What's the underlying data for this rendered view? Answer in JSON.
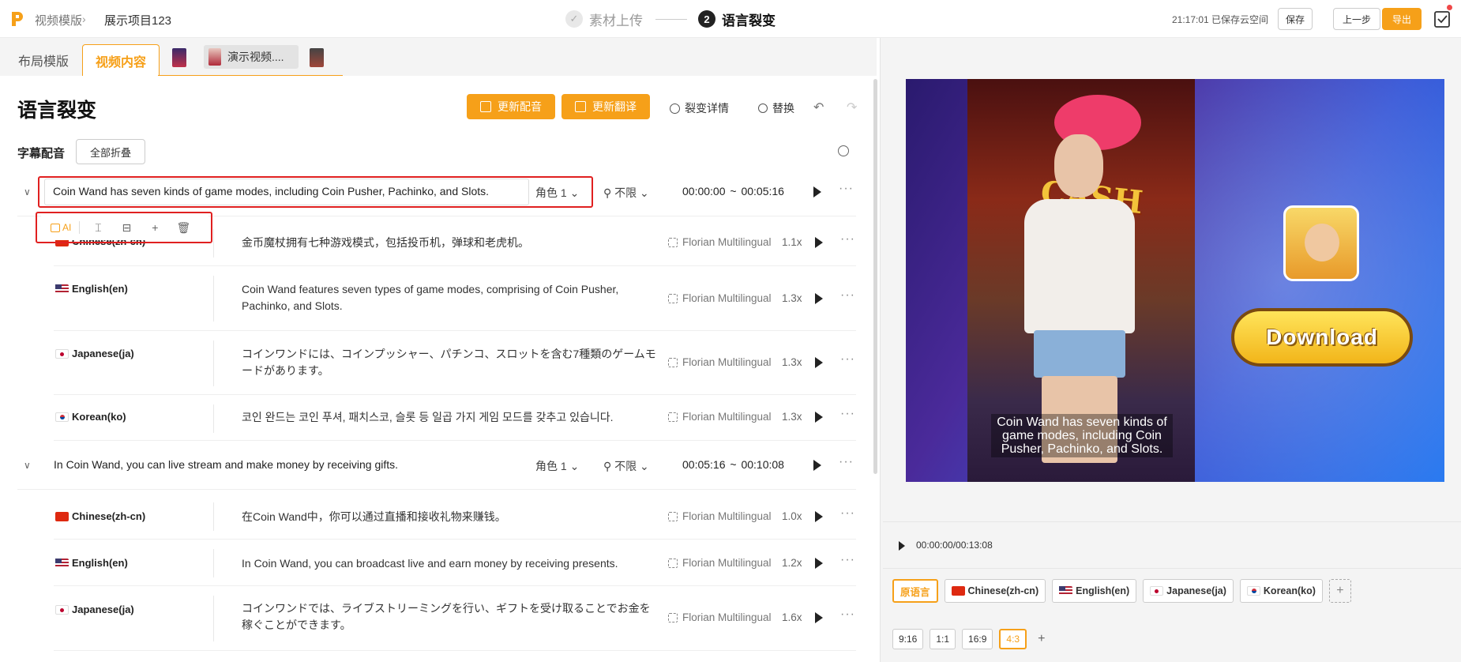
{
  "breadcrumb": {
    "root": "视频模版",
    "separator": "›",
    "project": "展示项目123"
  },
  "steps": [
    {
      "label": "素材上传",
      "done": true
    },
    {
      "label": "语言裂变",
      "number": "2"
    }
  ],
  "topbar": {
    "save_status": "21:17:01 已保存云空间",
    "save_label": "保存",
    "prev_label": "上一步",
    "export_label": "导出"
  },
  "tabs": {
    "layout": "布局模版",
    "video": "视频内容",
    "thumb_group_label": "演示视频...."
  },
  "left": {
    "title": "语言裂变",
    "update_dub": "更新配音",
    "update_trans": "更新翻译",
    "detail": "裂变详情",
    "replace": "替换",
    "undo": "↶",
    "redo": "↷",
    "section": "字幕配音",
    "collapse_all": "全部折叠"
  },
  "toolbar": {
    "ai_label": "AI",
    "split": "⌶",
    "merge": "⊟",
    "add": "+",
    "delete": "🗑"
  },
  "segments": [
    {
      "source": "Coin Wand has seven kinds of game modes, including Coin Pusher, Pachinko, and Slots.",
      "role": "角色 1 ⌄",
      "limit": "不限 ⌄",
      "start": "00:00:00",
      "sep": "~",
      "end": "00:05:16",
      "rows": [
        {
          "lang": "Chinese(zh-cn)",
          "flag": "cn",
          "text": "金币魔杖拥有七种游戏模式，包括投币机，弹球和老虎机。",
          "voice": "Florian Multilingual",
          "speed": "1.1x"
        },
        {
          "lang": "English(en)",
          "flag": "us",
          "text": "Coin Wand features seven types of game modes, comprising of Coin Pusher, Pachinko, and Slots.",
          "voice": "Florian Multilingual",
          "speed": "1.3x"
        },
        {
          "lang": "Japanese(ja)",
          "flag": "jp",
          "text": "コインワンドには、コインプッシャー、パチンコ、スロットを含む7種類のゲームモードがあります。",
          "voice": "Florian Multilingual",
          "speed": "1.3x"
        },
        {
          "lang": "Korean(ko)",
          "flag": "kr",
          "text": "코인 완드는 코인 푸셔, 패치스코, 슬롯 등 일곱 가지 게임 모드를 갖추고 있습니다.",
          "voice": "Florian Multilingual",
          "speed": "1.3x"
        }
      ]
    },
    {
      "source": "In Coin Wand, you can live stream and make money by receiving gifts.",
      "role": "角色 1 ⌄",
      "limit": "不限 ⌄",
      "start": "00:05:16",
      "sep": "~",
      "end": "00:10:08",
      "rows": [
        {
          "lang": "Chinese(zh-cn)",
          "flag": "cn",
          "text": "在Coin Wand中，你可以通过直播和接收礼物来赚钱。",
          "voice": "Florian Multilingual",
          "speed": "1.0x"
        },
        {
          "lang": "English(en)",
          "flag": "us",
          "text": "In Coin Wand, you can broadcast live and earn money by receiving presents.",
          "voice": "Florian Multilingual",
          "speed": "1.2x"
        },
        {
          "lang": "Japanese(ja)",
          "flag": "jp",
          "text": "コインワンドでは、ライブストリーミングを行い、ギフトを受け取ることでお金を稼ぐことができます。",
          "voice": "Florian Multilingual",
          "speed": "1.6x"
        }
      ]
    }
  ],
  "preview": {
    "caption": "Coin Wand has seven kinds of game modes, including Coin Pusher, Pachinko, and Slots.",
    "download_label": "Download",
    "sign_text": "CASH GY",
    "time": "00:00:00/00:13:08"
  },
  "lang_chips": [
    {
      "label": "原语言",
      "active": true
    },
    {
      "label": "Chinese(zh-cn)",
      "flag": "cn"
    },
    {
      "label": "English(en)",
      "flag": "us"
    },
    {
      "label": "Japanese(ja)",
      "flag": "jp"
    },
    {
      "label": "Korean(ko)",
      "flag": "kr"
    }
  ],
  "add_label": "+",
  "ratios": [
    {
      "label": "9:16"
    },
    {
      "label": "1:1"
    },
    {
      "label": "16:9"
    },
    {
      "label": "4:3",
      "active": true
    }
  ],
  "colors": {
    "accent": "#f6a019",
    "highlight_box": "#e02020"
  }
}
